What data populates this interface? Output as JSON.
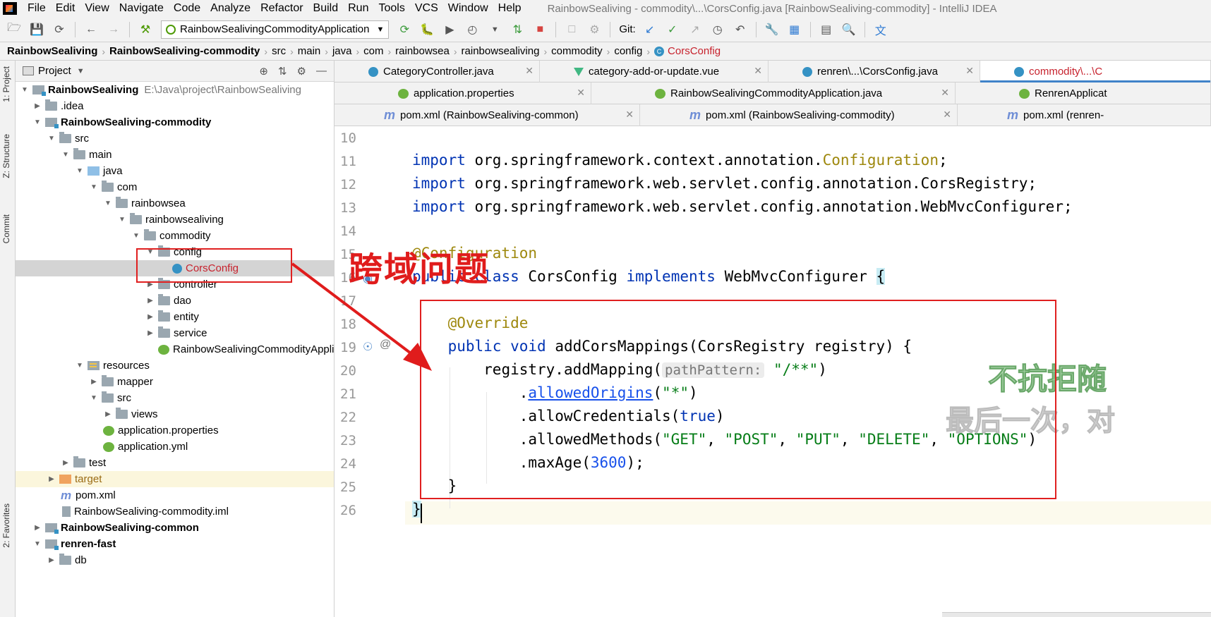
{
  "menu": {
    "items": [
      "File",
      "Edit",
      "View",
      "Navigate",
      "Code",
      "Analyze",
      "Refactor",
      "Build",
      "Run",
      "Tools",
      "VCS",
      "Window",
      "Help"
    ],
    "window_title": "RainbowSealiving - commodity\\...\\CorsConfig.java [RainbowSealiving-commodity] - IntelliJ IDEA"
  },
  "toolbar": {
    "run_config": "RainbowSealivingCommodityApplication",
    "git_label": "Git:"
  },
  "breadcrumb": [
    "RainbowSealiving",
    "RainbowSealiving-commodity",
    "src",
    "main",
    "java",
    "com",
    "rainbowsea",
    "rainbowsealiving",
    "commodity",
    "config",
    "CorsConfig"
  ],
  "tool_strip": {
    "project": "1: Project",
    "structure": "Z: Structure",
    "commit": "Commit",
    "favorites": "2: Favorites"
  },
  "project_panel": {
    "title": "Project",
    "tree": [
      {
        "label": "RainbowSealiving",
        "path": "E:\\Java\\project\\RainbowSealiving"
      },
      {
        "label": ".idea"
      },
      {
        "label": "RainbowSealiving-commodity"
      },
      {
        "label": "src"
      },
      {
        "label": "main"
      },
      {
        "label": "java"
      },
      {
        "label": "com"
      },
      {
        "label": "rainbowsea"
      },
      {
        "label": "rainbowsealiving"
      },
      {
        "label": "commodity"
      },
      {
        "label": "config"
      },
      {
        "label": "CorsConfig"
      },
      {
        "label": "controller"
      },
      {
        "label": "dao"
      },
      {
        "label": "entity"
      },
      {
        "label": "service"
      },
      {
        "label": "RainbowSealivingCommodityApplication"
      },
      {
        "label": "resources"
      },
      {
        "label": "mapper"
      },
      {
        "label": "src"
      },
      {
        "label": "views"
      },
      {
        "label": "application.properties"
      },
      {
        "label": "application.yml"
      },
      {
        "label": "test"
      },
      {
        "label": "target"
      },
      {
        "label": "pom.xml"
      },
      {
        "label": "RainbowSealiving-commodity.iml"
      },
      {
        "label": "RainbowSealiving-common"
      },
      {
        "label": "renren-fast"
      },
      {
        "label": "db"
      }
    ]
  },
  "editor": {
    "tabs_row1": [
      {
        "label": "CategoryController.java"
      },
      {
        "label": "category-add-or-update.vue"
      },
      {
        "label": "renren\\...\\CorsConfig.java"
      },
      {
        "label": "commodity\\...\\C"
      }
    ],
    "tabs_row2": [
      {
        "label": "application.properties"
      },
      {
        "label": "RainbowSealivingCommodityApplication.java"
      },
      {
        "label": "RenrenApplicat"
      }
    ],
    "tabs_row3": [
      {
        "label": "pom.xml (RainbowSealiving-common)"
      },
      {
        "label": "pom.xml (RainbowSealiving-commodity)"
      },
      {
        "label": "pom.xml (renren-"
      }
    ],
    "line_numbers": [
      "10",
      "11",
      "12",
      "13",
      "14",
      "15",
      "16",
      "17",
      "18",
      "19",
      "20",
      "21",
      "22",
      "23",
      "24",
      "25",
      "26"
    ],
    "code": {
      "l11_pkg": "org.springframework.context.annotation.",
      "l11_cls": "Configuration",
      "l12_pkg": "org.springframework.web.servlet.config.annotation.CorsRegistry;",
      "l13_pkg": "org.springframework.web.servlet.config.annotation.WebMvcConfigurer;",
      "kw_import": "import",
      "semicolon": ";",
      "l15_ann": "@Configuration",
      "kw_public": "public",
      "kw_class": "class",
      "class_name": "CorsConfig",
      "kw_implements": "implements",
      "iface": "WebMvcConfigurer",
      "open_brace": "{",
      "l18_ann": "@Override",
      "kw_void": "void",
      "method": "addCorsMappings(CorsRegistry registry) {",
      "l20_call": "registry.addMapping(",
      "l20_hint": "pathPattern:",
      "l20_arg": "\"/**\"",
      "close_paren": ")",
      "l21_dot": ".",
      "l21_method": "allowedOrigins",
      "l21_open": "(",
      "l21_arg": "\"*\"",
      "l22_call": ".allowCredentials(",
      "l22_arg": "true",
      "l23_call": ".allowedMethods(",
      "l23_a1": "\"GET\"",
      "l23_a2": "\"POST\"",
      "l23_a3": "\"PUT\"",
      "l23_a4": "\"DELETE\"",
      "l23_a5": "\"OPTIONS\"",
      "comma": ", ",
      "l24_call": ".maxAge(",
      "l24_arg": "3600",
      "l24_end": ");",
      "l25_close": "}",
      "l26_close": "}"
    }
  },
  "overlay": {
    "title": "跨域问题",
    "watermark_1": "不抗拒随",
    "watermark_2": "最后一次，对"
  }
}
